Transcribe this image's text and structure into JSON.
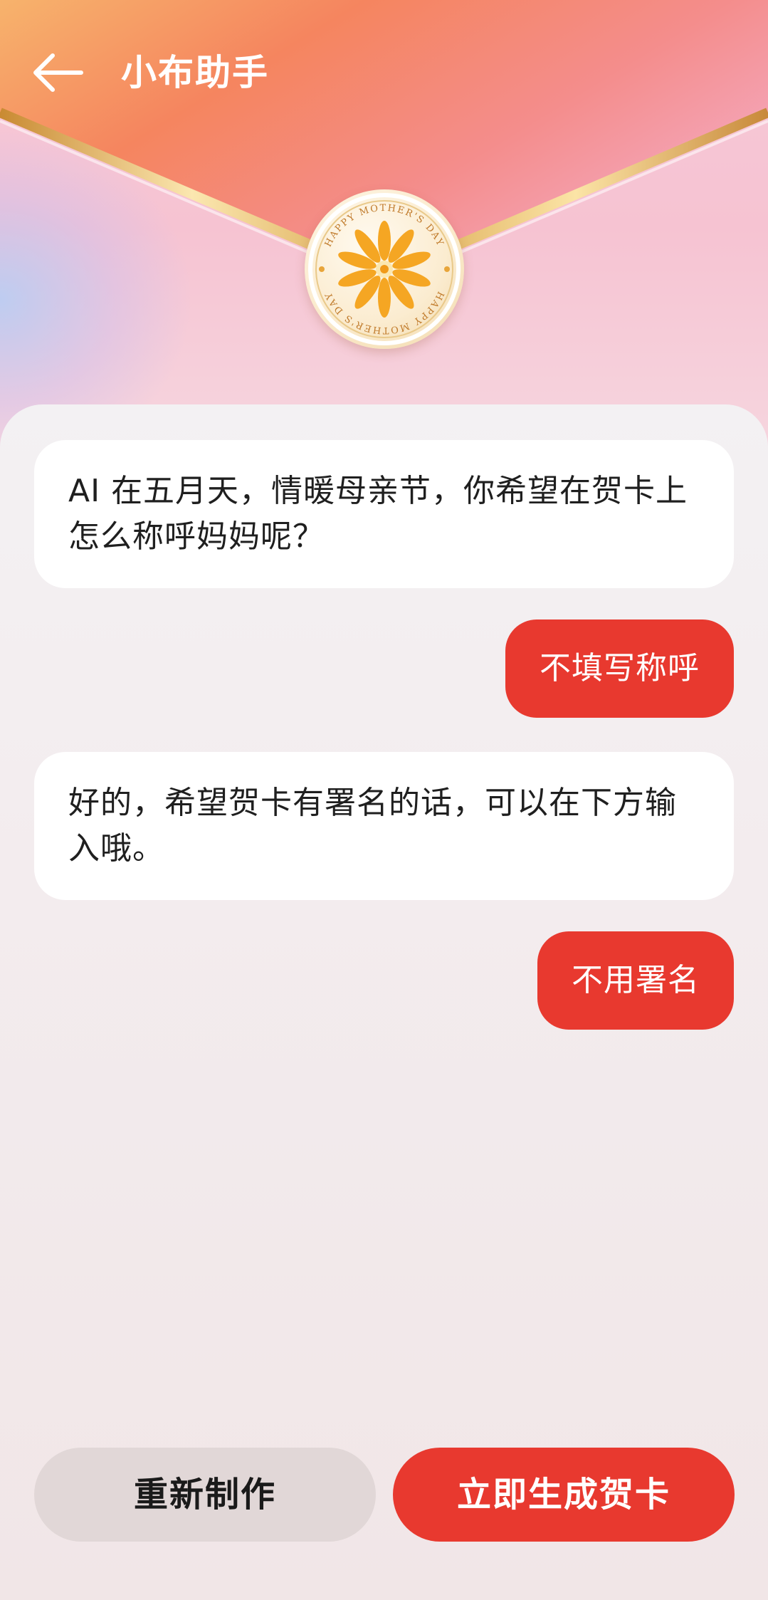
{
  "header": {
    "back_icon": "arrow-left-icon",
    "title": "小布助手"
  },
  "seal": {
    "icon": "flower-icon",
    "text_top": "HAPPY MOTHER'S DAY",
    "text_bottom": "HAPPY MOTHER'S DAY"
  },
  "chat": {
    "messages": [
      {
        "role": "assistant",
        "text": "AI 在五月天，情暖母亲节，你希望在贺卡上怎么称呼妈妈呢？"
      },
      {
        "role": "user",
        "text": "不填写称呼"
      },
      {
        "role": "assistant",
        "text": "好的，希望贺卡有署名的话，可以在下方输入哦。"
      },
      {
        "role": "user",
        "text": "不用署名"
      }
    ]
  },
  "actions": {
    "redo_label": "重新制作",
    "generate_label": "立即生成贺卡"
  },
  "colors": {
    "accent": "#e8392f",
    "secondary_button": "#e1d7d7",
    "envelope_flap": "#f58a63",
    "gold_trim": "#d6a24a"
  }
}
